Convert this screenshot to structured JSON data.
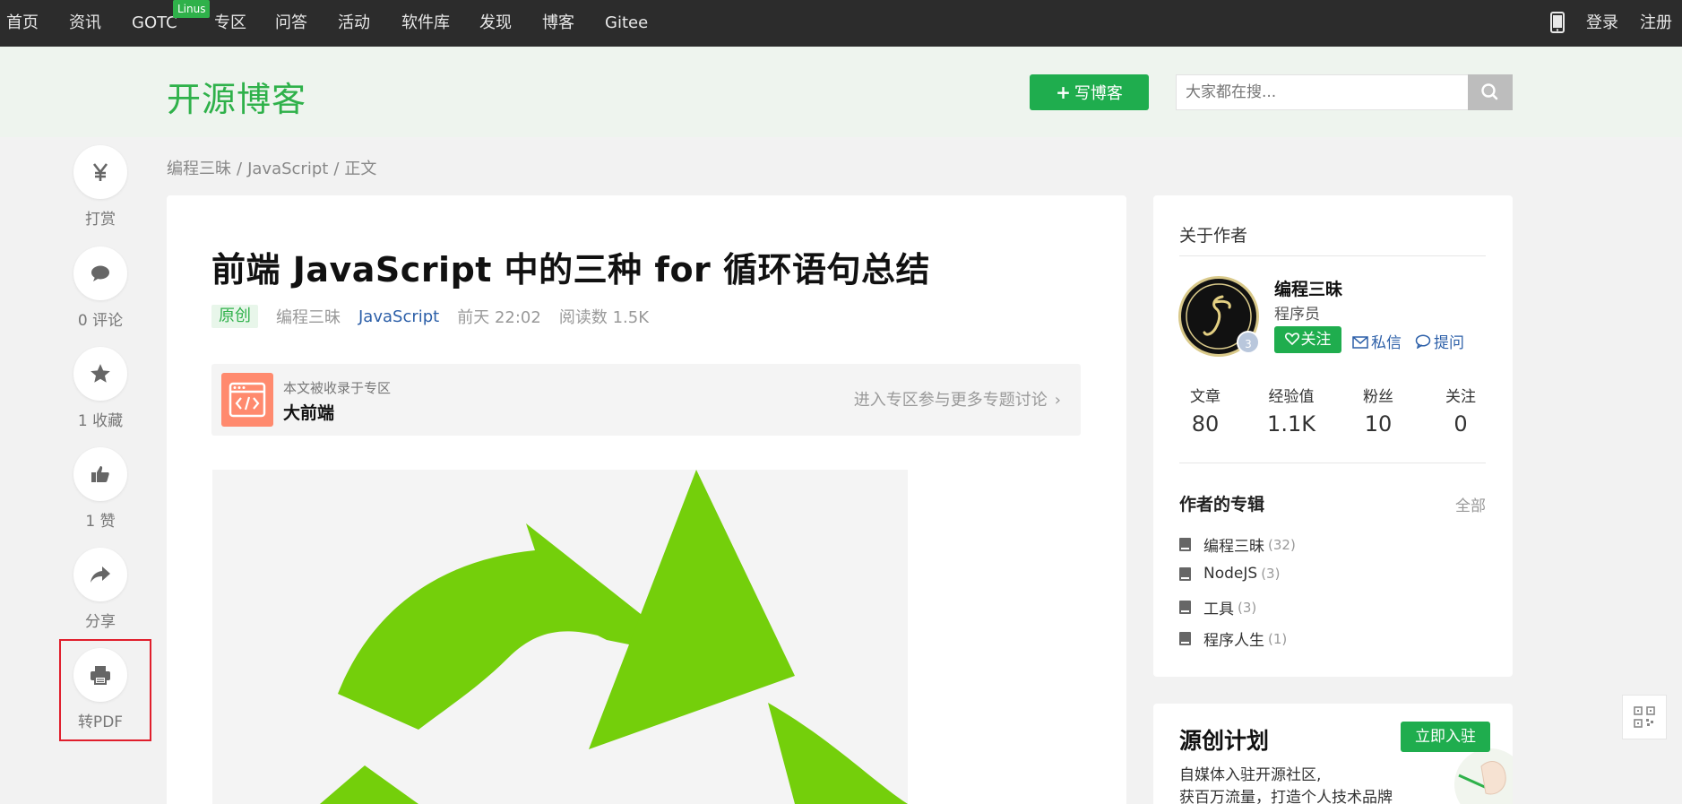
{
  "topnav": {
    "items": [
      "首页",
      "资讯",
      "GOTC",
      "专区",
      "问答",
      "活动",
      "软件库",
      "发现",
      "博客",
      "Gitee"
    ],
    "badge": "Linus",
    "login": "登录",
    "register": "注册"
  },
  "header": {
    "brand": "开源博客",
    "write_button": "写博客",
    "search_placeholder": "大家都在搜..."
  },
  "rail": {
    "reward": "打赏",
    "comment": "0 评论",
    "favorite": "1 收藏",
    "like": "1 赞",
    "share": "分享",
    "pdf": "转PDF"
  },
  "breadcrumb": [
    "编程三昧",
    "JavaScript",
    "正文"
  ],
  "article": {
    "title": "前端 JavaScript 中的三种 for 循环语句总结",
    "tag": "原创",
    "author": "编程三昧",
    "category": "JavaScript",
    "time": "前天 22:02",
    "reads": "阅读数 1.5K",
    "zone": {
      "subtitle": "本文被收录于专区",
      "name": "大前端",
      "link": "进入专区参与更多专题讨论"
    }
  },
  "author_card": {
    "title": "关于作者",
    "name": "编程三昧",
    "role": "程序员",
    "level": "3",
    "follow": "关注",
    "message": "私信",
    "ask": "提问",
    "stats": [
      {
        "label": "文章",
        "value": "80"
      },
      {
        "label": "经验值",
        "value": "1.1K"
      },
      {
        "label": "粉丝",
        "value": "10"
      },
      {
        "label": "关注",
        "value": "0"
      }
    ],
    "collections_title": "作者的专辑",
    "collections_all": "全部",
    "collections": [
      {
        "name": "编程三昧",
        "count": "(32)"
      },
      {
        "name": "NodeJS",
        "count": "(3)"
      },
      {
        "name": "工具",
        "count": "(3)"
      },
      {
        "name": "程序人生",
        "count": "(1)"
      }
    ]
  },
  "plan": {
    "title": "源创计划",
    "button": "立即入驻",
    "desc_line1": "自媒体入驻开源社区,",
    "desc_line2": "获百万流量，打造个人技术品牌"
  },
  "colors": {
    "brand_green": "#2fb14a",
    "button_green": "#1fad4e",
    "link_blue": "#2c5fa8",
    "highlight_red": "#e01e2c"
  }
}
